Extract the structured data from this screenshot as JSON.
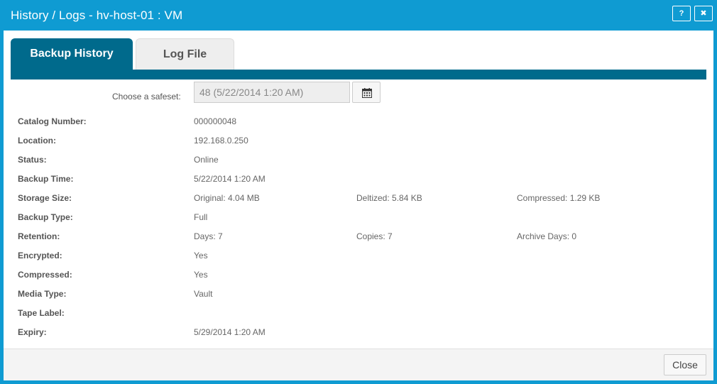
{
  "window": {
    "title": "History / Logs - hv-host-01 : VM",
    "help_label": "?",
    "close_label": "✖"
  },
  "tabs": [
    {
      "label": "Backup History",
      "active": true
    },
    {
      "label": "Log File",
      "active": false
    }
  ],
  "safeset": {
    "label": "Choose a safeset:",
    "value": "48 (5/22/2014 1:20 AM)"
  },
  "details": {
    "catalog_number": {
      "label": "Catalog Number:",
      "value": "000000048"
    },
    "location": {
      "label": "Location:",
      "value": "192.168.0.250"
    },
    "status": {
      "label": "Status:",
      "value": "Online"
    },
    "backup_time": {
      "label": "Backup Time:",
      "value": "5/22/2014 1:20 AM"
    },
    "storage_size": {
      "label": "Storage Size:",
      "original": "Original: 4.04 MB",
      "deltized": "Deltized: 5.84 KB",
      "compressed": "Compressed: 1.29 KB"
    },
    "backup_type": {
      "label": "Backup Type:",
      "value": "Full"
    },
    "retention": {
      "label": "Retention:",
      "days": "Days: 7",
      "copies": "Copies: 7",
      "archive_days": "Archive Days: 0"
    },
    "encrypted": {
      "label": "Encrypted:",
      "value": "Yes"
    },
    "compressed": {
      "label": "Compressed:",
      "value": "Yes"
    },
    "media_type": {
      "label": "Media Type:",
      "value": "Vault"
    },
    "tape_label": {
      "label": "Tape Label:",
      "value": ""
    },
    "expiry": {
      "label": "Expiry:",
      "value": "5/29/2014 1:20 AM"
    }
  },
  "footer": {
    "close_label": "Close"
  },
  "colors": {
    "titlebar": "#0f9bd2",
    "tab_active": "#006a8c",
    "tab_inactive": "#eeeeee"
  }
}
